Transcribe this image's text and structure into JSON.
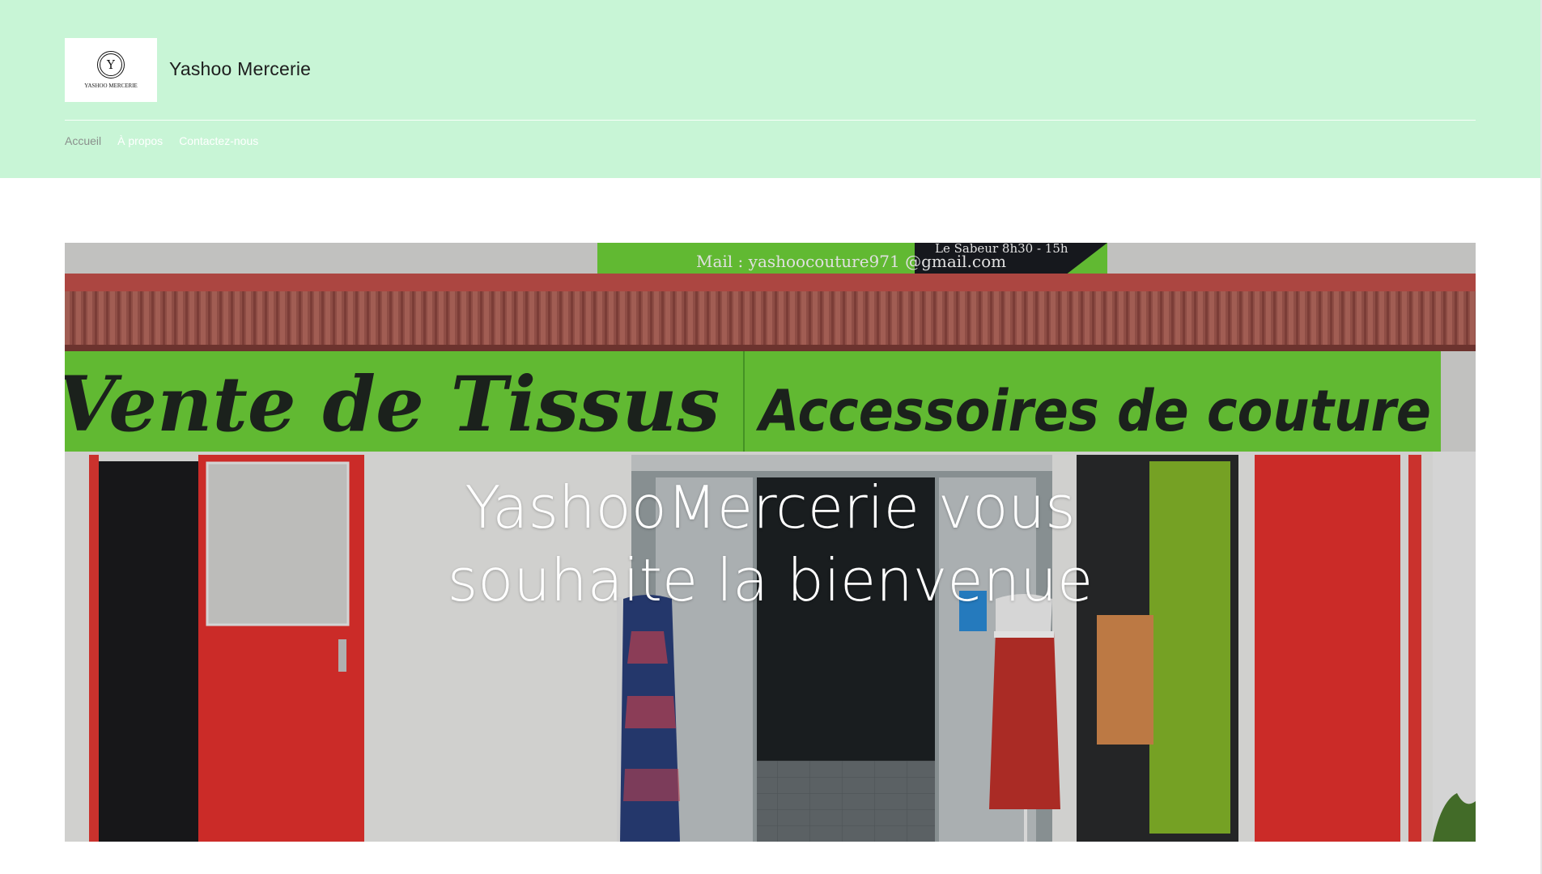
{
  "header": {
    "logo": {
      "letter": "Y",
      "caption": "YASHOO MERCERIE"
    },
    "site_title": "Yashoo Mercerie",
    "nav": [
      {
        "label": "Accueil",
        "active": true
      },
      {
        "label": "À propos",
        "active": false
      },
      {
        "label": "Contactez-nous",
        "active": false
      }
    ]
  },
  "hero": {
    "heading_line1": "YashooMercerie vous",
    "heading_line2": "souhaite la bienvenue",
    "storefront_sign_left": "Vente de Tissus",
    "storefront_sign_right": "Accessoires de couture",
    "storefront_top_sign_mail": "Mail : yashoocouture971 @gmail.com",
    "storefront_top_sign_place": "Le Sabeur 8h30 - 15h"
  },
  "colors": {
    "header_bg": "#c8f5d6",
    "sign_green": "#6fd33a",
    "door_red": "#e8312e"
  }
}
